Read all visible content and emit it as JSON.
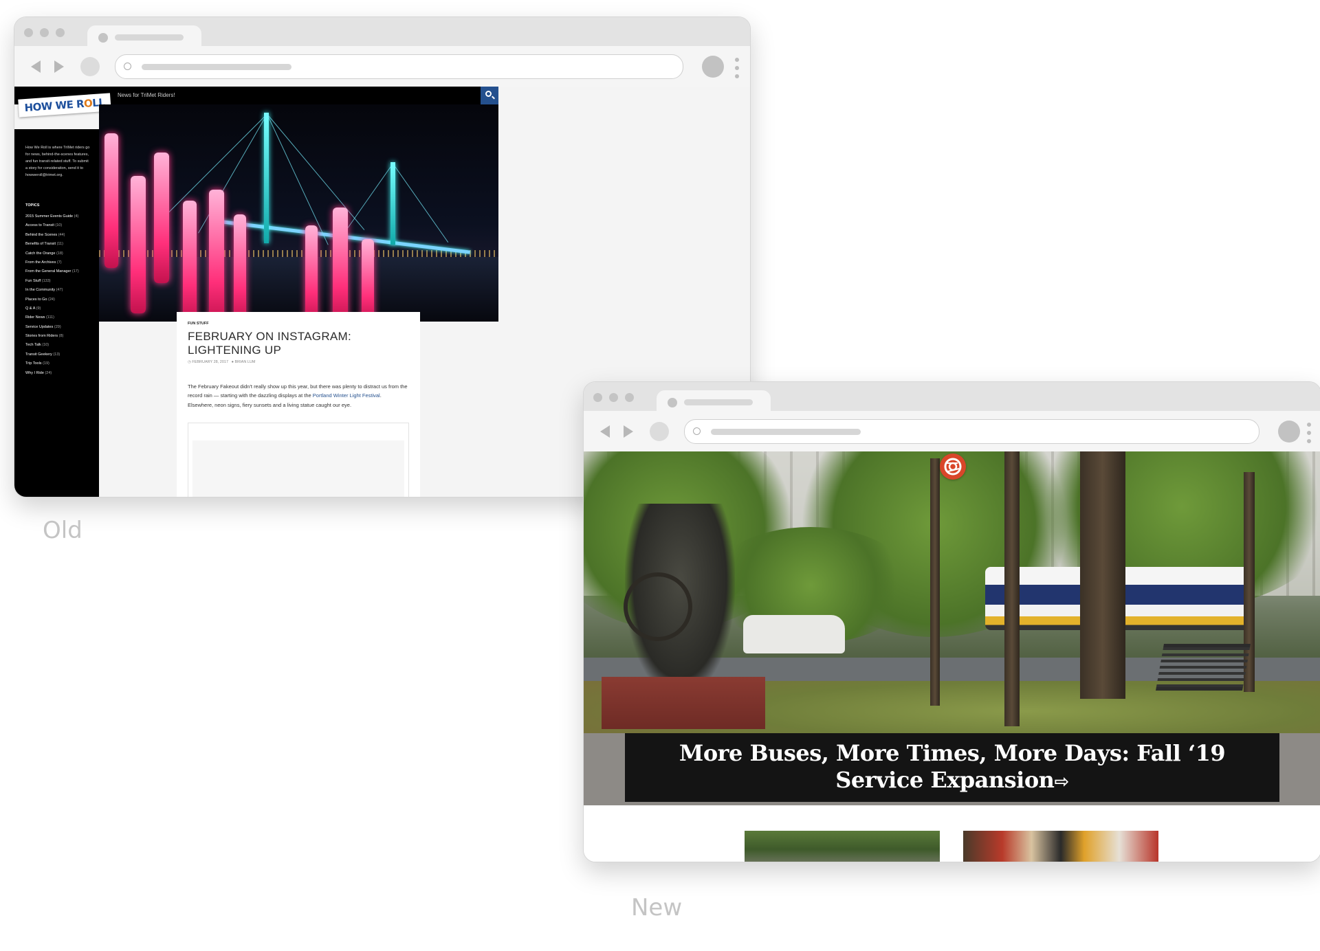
{
  "old_site": {
    "caption": "Old",
    "logo_text": "HOW WE ROLL",
    "tagline": "News for TriMet Riders!",
    "search_icon": "search-icon",
    "about_text": "How We Roll is where TriMet riders go for news, behind-the-scenes features, and fun transit-related stuff. To submit a story for consideration, send it to howweroll@trimet.org.",
    "topics_heading": "TOPICS",
    "topics": [
      {
        "name": "2015 Summer Events Guide",
        "count": "(4)"
      },
      {
        "name": "Access to Transit",
        "count": "(10)"
      },
      {
        "name": "Behind the Scenes",
        "count": "(44)"
      },
      {
        "name": "Benefits of Transit",
        "count": "(11)"
      },
      {
        "name": "Catch the Orange",
        "count": "(18)"
      },
      {
        "name": "From the Archives",
        "count": "(7)"
      },
      {
        "name": "From the General Manager",
        "count": "(17)"
      },
      {
        "name": "Fun Stuff",
        "count": "(133)"
      },
      {
        "name": "In the Community",
        "count": "(47)"
      },
      {
        "name": "Places to Go",
        "count": "(24)"
      },
      {
        "name": "Q & A",
        "count": "(9)"
      },
      {
        "name": "Rider News",
        "count": "(111)"
      },
      {
        "name": "Service Updates",
        "count": "(29)"
      },
      {
        "name": "Stories from Riders",
        "count": "(8)"
      },
      {
        "name": "Tech Talk",
        "count": "(10)"
      },
      {
        "name": "Transit Geekery",
        "count": "(13)"
      },
      {
        "name": "Trip Tools",
        "count": "(19)"
      },
      {
        "name": "Why I Ride",
        "count": "(24)"
      }
    ],
    "post": {
      "category": "FUN STUFF",
      "title": "FEBRUARY ON INSTAGRAM: LIGHTENING UP",
      "date": "FEBRUARY 28, 2017",
      "author": "BRIAN LUM",
      "excerpt_before": "The February Fakeout didn't really show up this year, but there was plenty to distract us from the record rain — starting with the dazzling displays at the ",
      "excerpt_link": "Portland Winter Light Festival",
      "excerpt_after": ". Elsewhere, neon signs, fiery sunsets and a living statue caught our eye."
    }
  },
  "new_site": {
    "caption": "New",
    "logo_icon": "trimet-logo-icon",
    "headline": "More Buses, More Times, More Days: Fall ‘19 Service Expansion",
    "headline_arrow": "⇨"
  },
  "colors": {
    "old_search_bg": "#24508e",
    "old_logo_blue": "#1d4f9c",
    "old_logo_orange": "#e07b1a",
    "new_logo_red": "#d9462a",
    "caption_gray": "#c4c4c4"
  }
}
